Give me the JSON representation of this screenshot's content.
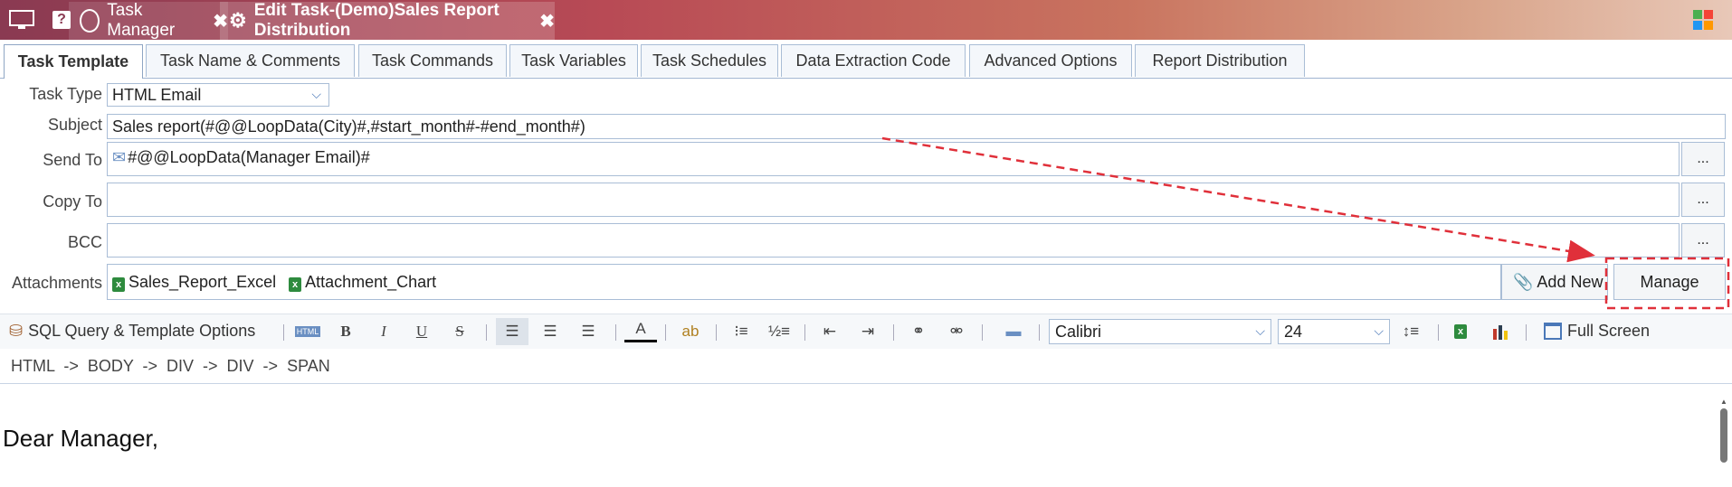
{
  "titlebar": {
    "tabs": [
      {
        "label": "Task Manager"
      },
      {
        "label": "Edit Task-(Demo)Sales Report Distribution"
      }
    ]
  },
  "tabs": [
    "Task Template",
    "Task Name & Comments",
    "Task Commands",
    "Task Variables",
    "Task Schedules",
    "Data Extraction Code",
    "Advanced Options",
    "Report Distribution"
  ],
  "form": {
    "task_type_label": "Task Type",
    "task_type_value": "HTML Email",
    "subject_label": "Subject",
    "subject_value": "Sales report(#@@LoopData(City)#,#start_month#-#end_month#)",
    "send_to_label": "Send To",
    "send_to_value": "#@@LoopData(Manager Email)#",
    "copy_to_label": "Copy To",
    "bcc_label": "BCC",
    "dots": "...",
    "attachments_label": "Attachments",
    "attachments": [
      "Sales_Report_Excel",
      "Attachment_Chart"
    ],
    "add_new_label": "Add New",
    "manage_label": "Manage"
  },
  "toolbar": {
    "sql_label": "SQL Query & Template Options",
    "font_value": "Calibri",
    "size_value": "24",
    "fullscreen_label": "Full Screen"
  },
  "breadcrumb": {
    "path": "HTML  ->  BODY  ->  DIV  ->  DIV  ->  SPAN"
  },
  "editor": {
    "text": "Dear Manager,"
  },
  "colors": {
    "accent": "#4a78b8",
    "annotation": "#e0303a"
  }
}
